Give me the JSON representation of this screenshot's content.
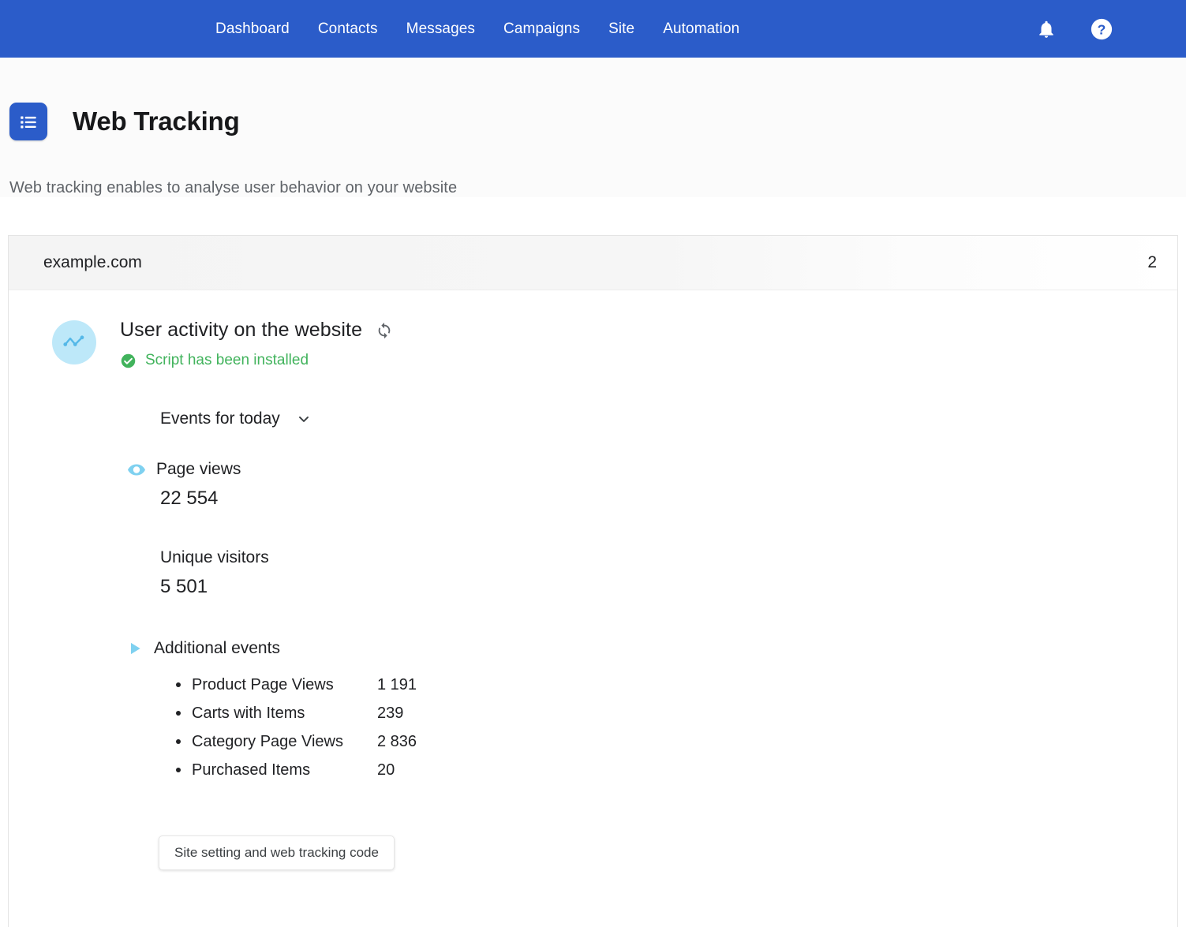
{
  "nav": {
    "items": [
      {
        "label": "Dashboard"
      },
      {
        "label": "Contacts"
      },
      {
        "label": "Messages"
      },
      {
        "label": "Campaigns"
      },
      {
        "label": "Site"
      },
      {
        "label": "Automation"
      }
    ],
    "icons": [
      {
        "name": "notifications-bell-icon"
      },
      {
        "name": "help-question-icon"
      }
    ],
    "background_color": "#2b5cc9"
  },
  "page": {
    "badge_icon": "list-icon",
    "title": "Web Tracking",
    "subtitle": "Web tracking enables to analyse user behavior on your website"
  },
  "card": {
    "header": {
      "domain": "example.com",
      "count": "2"
    },
    "activity": {
      "avatar_icon": "line-chart-icon",
      "title": "User activity on the website",
      "refresh_icon": "refresh-sync-icon",
      "status_icon": "check-circle-icon",
      "status_text": "Script has been installed",
      "status_color": "#41b35c"
    },
    "period_select": {
      "value": "Events for today",
      "chevron_icon": "chevron-down-icon"
    },
    "metrics": [
      {
        "icon": "eye-icon",
        "label": "Page views",
        "value": "22 554"
      },
      {
        "icon": "",
        "label": "Unique visitors",
        "value": "5 501"
      }
    ],
    "additional_events": {
      "toggle_icon": "play-triangle-icon",
      "title": "Additional events",
      "items": [
        {
          "name": "Product Page Views",
          "value": "1 191"
        },
        {
          "name": "Carts with Items",
          "value": "239"
        },
        {
          "name": "Category Page Views",
          "value": "2 836"
        },
        {
          "name": "Purchased Items",
          "value": "20"
        }
      ]
    },
    "footer_button": {
      "label": "Site setting and web tracking code"
    }
  }
}
